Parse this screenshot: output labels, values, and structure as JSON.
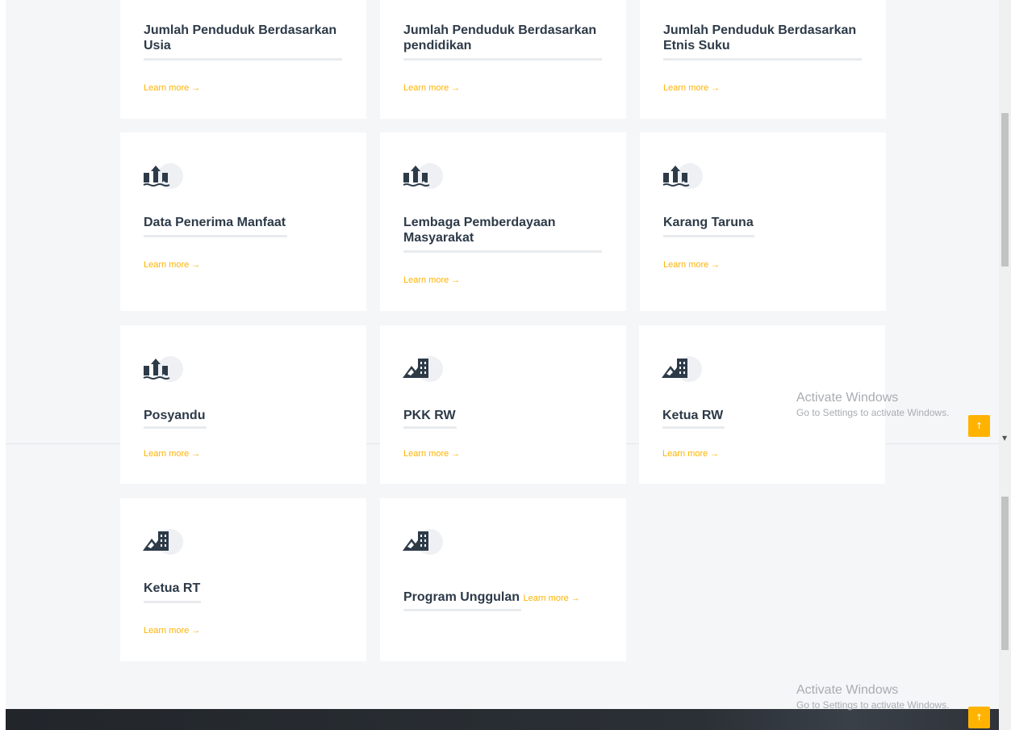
{
  "cards": [
    {
      "title": "Jumlah Penduduk Berdasarkan Usia",
      "icon": "",
      "link": "Learn more →"
    },
    {
      "title": "Jumlah Penduduk Berdasarkan pendidikan",
      "icon": "",
      "link": "Learn more →"
    },
    {
      "title": "Jumlah Penduduk Berdasarkan Etnis Suku",
      "icon": "",
      "link": "Learn more →"
    },
    {
      "title": "Data Penerima Manfaat",
      "icon": "upload-chart-icon",
      "link": "Learn more →"
    },
    {
      "title": "Lembaga Pemberdayaan Masyarakat",
      "icon": "upload-chart-icon",
      "link": "Learn more →"
    },
    {
      "title": "Karang Taruna",
      "icon": "upload-chart-icon",
      "link": "Learn more →"
    },
    {
      "title": "Posyandu",
      "icon": "upload-chart-icon",
      "link": "Learn more →"
    },
    {
      "title": "PKK RW",
      "icon": "mountain-building-icon",
      "link": "Learn more →"
    },
    {
      "title": "Ketua RW",
      "icon": "mountain-building-icon",
      "link": "Learn more →"
    },
    {
      "title": "Ketua RT",
      "icon": "mountain-building-icon",
      "link": "Learn more →"
    },
    {
      "title": "Program Unggulan",
      "icon": "mountain-building-icon",
      "link": "Learn more →"
    }
  ],
  "watermark": {
    "title": "Activate Windows",
    "subtitle": "Go to Settings to activate Windows."
  },
  "back_to_top": "↑",
  "colors": {
    "accent": "#ffb300",
    "title": "#2d3a48",
    "background": "#f5f6f8",
    "card": "#ffffff"
  }
}
